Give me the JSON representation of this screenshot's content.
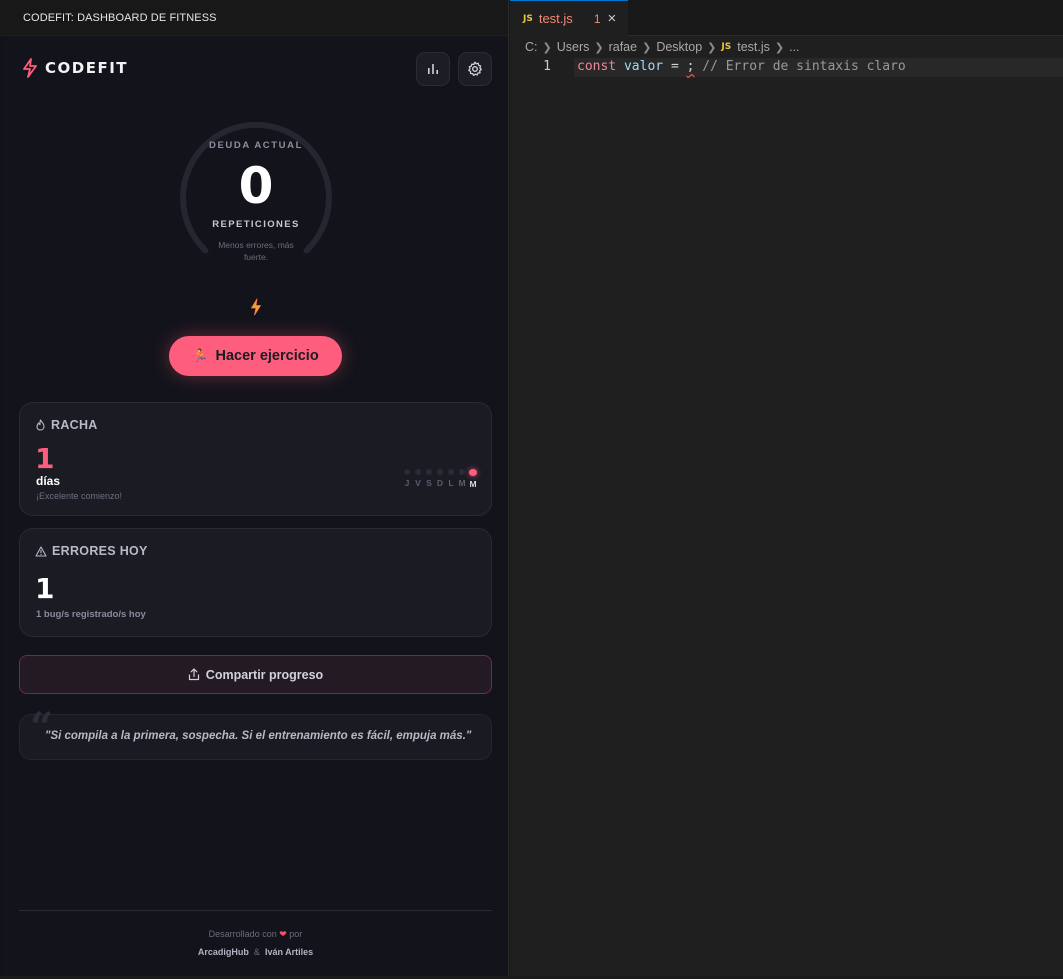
{
  "panel": {
    "header_title": "CODEFIT: DASHBOARD DE FITNESS"
  },
  "app": {
    "brand": "CODEFIT",
    "gauge": {
      "title": "DEUDA ACTUAL",
      "value": "0",
      "unit": "REPETICIONES",
      "subtitle": "Menos errores, más fuerte."
    },
    "cta_label": "Hacer ejercicio",
    "streak": {
      "title": "RACHA",
      "value": "1",
      "unit": "días",
      "message": "¡Excelente comienzo!",
      "days": [
        {
          "label": "J",
          "active": false
        },
        {
          "label": "V",
          "active": false
        },
        {
          "label": "S",
          "active": false
        },
        {
          "label": "D",
          "active": false
        },
        {
          "label": "L",
          "active": false
        },
        {
          "label": "M",
          "active": false
        },
        {
          "label": "M",
          "active": true
        }
      ]
    },
    "errors": {
      "title": "ERRORES HOY",
      "value": "1",
      "message": "1 bug/s registrado/s hoy"
    },
    "share_label": "Compartir progreso",
    "quote": "\"Si compila a la primera, sospecha. Si el entrenamiento es fácil, empuja más.\"",
    "footer": {
      "made_with": "Desarrollado con",
      "by": "por",
      "author1": "ArcadigHub",
      "amp": "&",
      "author2": "Iván Artiles"
    },
    "colors": {
      "accent": "#ff5d7e",
      "bg": "#13131b",
      "card": "#1b1b24"
    }
  },
  "editor": {
    "tab": {
      "icon": "JS",
      "filename": "test.js",
      "problems": "1"
    },
    "breadcrumb": [
      "C:",
      "Users",
      "rafae",
      "Desktop",
      "test.js",
      "..."
    ],
    "line_number": "1",
    "code": {
      "keyword": "const",
      "variable": "valor",
      "operator": "=",
      "error_token": ";",
      "comment": "// Error de sintaxis claro"
    }
  }
}
